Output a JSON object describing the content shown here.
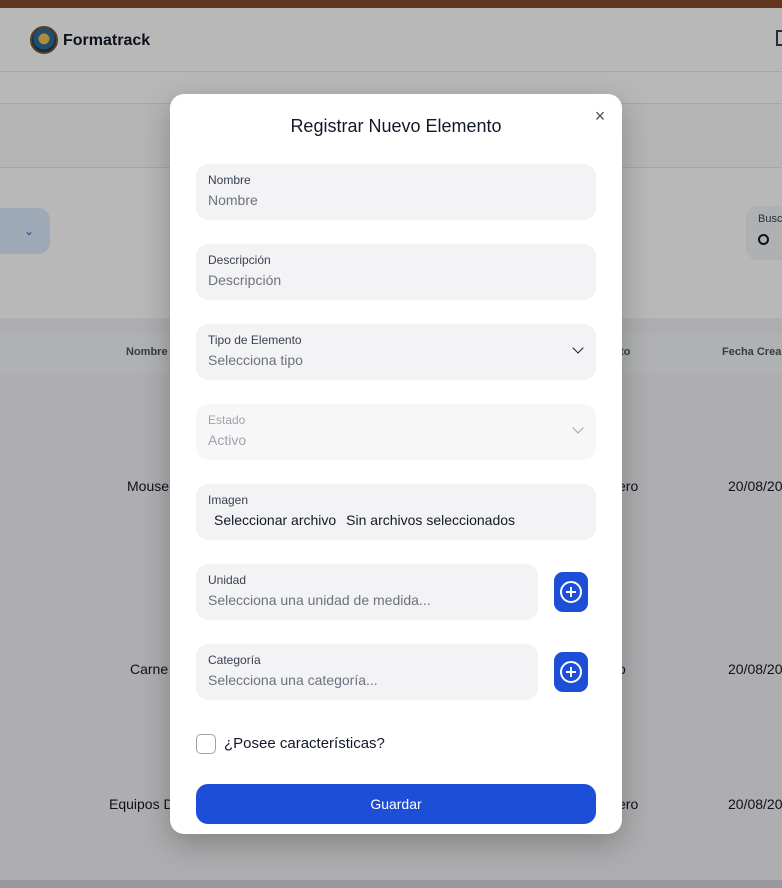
{
  "app": {
    "brand": "Formatrack"
  },
  "background": {
    "search_label": "Busc",
    "table_headers": [
      "Nombre",
      "to",
      "Fecha Crea"
    ],
    "rows": [
      {
        "name": "Mouse",
        "status": "ero",
        "date": "20/08/20"
      },
      {
        "name": "Carne",
        "status": "o",
        "date": "20/08/20"
      },
      {
        "name": "Equipos D",
        "status": "ero",
        "date": "20/08/20"
      }
    ]
  },
  "modal": {
    "title": "Registrar Nuevo Elemento",
    "close": "×",
    "fields": {
      "nombre": {
        "label": "Nombre",
        "placeholder": "Nombre"
      },
      "descripcion": {
        "label": "Descripción",
        "placeholder": "Descripción"
      },
      "tipo": {
        "label": "Tipo de Elemento",
        "value": "Selecciona tipo"
      },
      "estado": {
        "label": "Estado",
        "value": "Activo"
      },
      "imagen": {
        "label": "Imagen",
        "button": "Seleccionar archivo",
        "status": "Sin archivos seleccionados"
      },
      "unidad": {
        "label": "Unidad",
        "value": "Selecciona una unidad de medida..."
      },
      "categoria": {
        "label": "Categoría",
        "value": "Selecciona una categoría..."
      }
    },
    "checkbox_label": "¿Posee características?",
    "save_label": "Guardar"
  },
  "colors": {
    "primary": "#1d4ed8",
    "field_bg": "#f3f3f5"
  }
}
